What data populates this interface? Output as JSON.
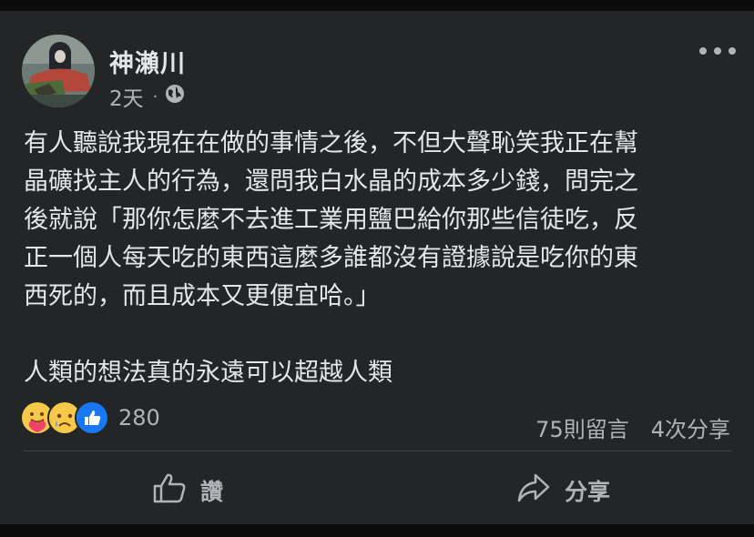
{
  "post": {
    "author": "神瀨川",
    "time": "2天",
    "separator": "·",
    "body": "有人聽說我現在在做的事情之後，不但大聲恥笑我正在幫\n晶礦找主人的行為，還問我白水晶的成本多少錢，問完之\n後就說「那你怎麼不去進工業用鹽巴給你那些信徒吃，反\n正一個人每天吃的東西這麼多誰都沒有證據說是吃你的東\n西死的，而且成本又更便宜哈。」\n\n人類的想法真的永遠可以超越人類"
  },
  "engagement": {
    "reaction_icons": [
      "care-icon",
      "sad-icon",
      "like-icon"
    ],
    "reaction_count": "280",
    "comments": "75則留言",
    "shares": "4次分享"
  },
  "actions": {
    "like_label": "讚",
    "share_label": "分享"
  },
  "colors": {
    "background": "#242526",
    "text_primary": "#e4e6eb",
    "text_secondary": "#b0b3b8",
    "like_blue": "#1877f2"
  }
}
